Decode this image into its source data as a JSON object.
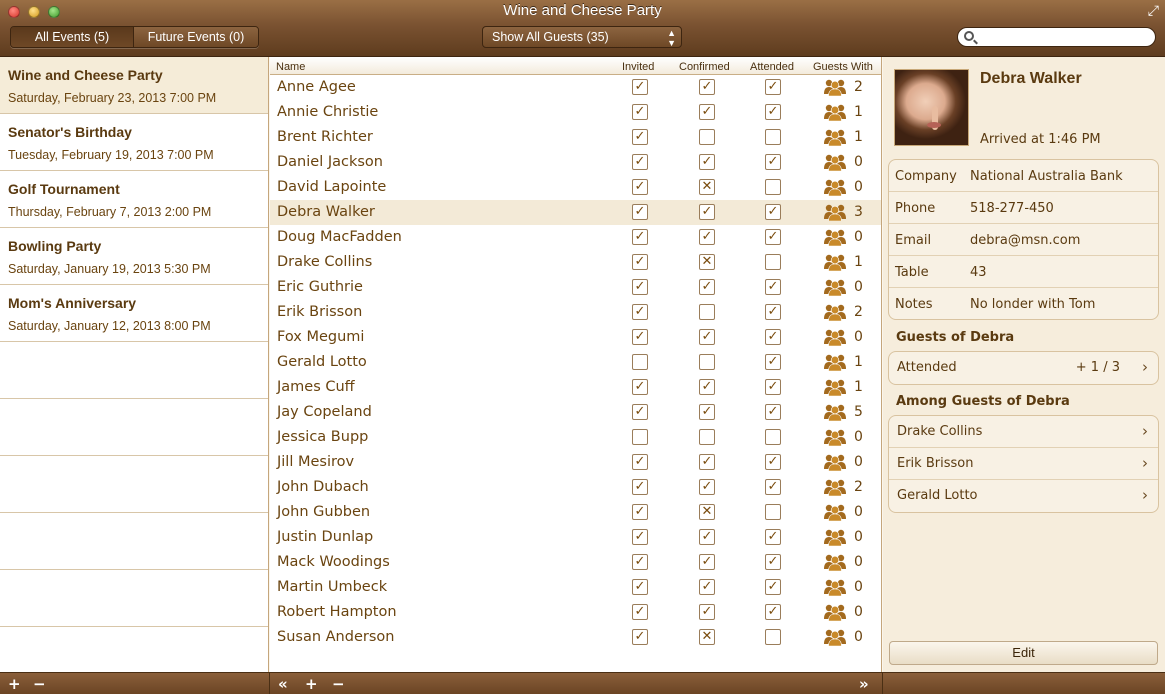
{
  "window": {
    "title": "Wine and Cheese Party"
  },
  "toolbar": {
    "all_events": "All Events (5)",
    "future_events": "Future Events (0)",
    "guest_filter": "Show All Guests (35)",
    "search_placeholder": ""
  },
  "events": [
    {
      "name": "Wine and Cheese Party",
      "date": "Saturday, February 23, 2013 7:00 PM",
      "selected": true
    },
    {
      "name": "Senator's Birthday",
      "date": "Tuesday, February 19, 2013 7:00 PM"
    },
    {
      "name": "Golf Tournament",
      "date": "Thursday, February 7, 2013 2:00 PM"
    },
    {
      "name": "Bowling Party",
      "date": "Saturday, January 19, 2013 5:30 PM"
    },
    {
      "name": "Mom's Anniversary",
      "date": "Saturday, January 12, 2013 8:00 PM"
    }
  ],
  "table": {
    "headers": {
      "name": "Name",
      "invited": "Invited",
      "confirmed": "Confirmed",
      "attended": "Attended",
      "guests_with": "Guests With"
    },
    "rows": [
      {
        "name": "Anne Agee",
        "invited": "check",
        "confirmed": "check",
        "attended": "check",
        "guests": "2"
      },
      {
        "name": "Annie Christie",
        "invited": "check",
        "confirmed": "check",
        "attended": "check",
        "guests": "1"
      },
      {
        "name": "Brent Richter",
        "invited": "check",
        "confirmed": "empty",
        "attended": "empty",
        "guests": "1"
      },
      {
        "name": "Daniel Jackson",
        "invited": "check",
        "confirmed": "check",
        "attended": "check",
        "guests": "0"
      },
      {
        "name": "David Lapointe",
        "invited": "check",
        "confirmed": "cross",
        "attended": "empty",
        "guests": "0"
      },
      {
        "name": "Debra Walker",
        "invited": "check",
        "confirmed": "check",
        "attended": "check",
        "guests": "3",
        "selected": true
      },
      {
        "name": "Doug MacFadden",
        "invited": "check",
        "confirmed": "check",
        "attended": "check",
        "guests": "0"
      },
      {
        "name": "Drake Collins",
        "invited": "check",
        "confirmed": "cross",
        "attended": "empty",
        "guests": "1"
      },
      {
        "name": "Eric Guthrie",
        "invited": "check",
        "confirmed": "check",
        "attended": "check",
        "guests": "0"
      },
      {
        "name": "Erik Brisson",
        "invited": "check",
        "confirmed": "empty",
        "attended": "check",
        "guests": "2"
      },
      {
        "name": "Fox Megumi",
        "invited": "check",
        "confirmed": "check",
        "attended": "check",
        "guests": "0"
      },
      {
        "name": "Gerald Lotto",
        "invited": "empty",
        "confirmed": "empty",
        "attended": "check",
        "guests": "1"
      },
      {
        "name": "James Cuff",
        "invited": "check",
        "confirmed": "check",
        "attended": "check",
        "guests": "1"
      },
      {
        "name": "Jay Copeland",
        "invited": "check",
        "confirmed": "check",
        "attended": "check",
        "guests": "5"
      },
      {
        "name": "Jessica Bupp",
        "invited": "empty",
        "confirmed": "empty",
        "attended": "empty",
        "guests": "0"
      },
      {
        "name": "Jill Mesirov",
        "invited": "check",
        "confirmed": "check",
        "attended": "check",
        "guests": "0"
      },
      {
        "name": "John Dubach",
        "invited": "check",
        "confirmed": "check",
        "attended": "check",
        "guests": "2"
      },
      {
        "name": "John Gubben",
        "invited": "check",
        "confirmed": "cross",
        "attended": "empty",
        "guests": "0"
      },
      {
        "name": "Justin Dunlap",
        "invited": "check",
        "confirmed": "check",
        "attended": "check",
        "guests": "0"
      },
      {
        "name": "Mack Woodings",
        "invited": "check",
        "confirmed": "check",
        "attended": "check",
        "guests": "0"
      },
      {
        "name": "Martin Umbeck",
        "invited": "check",
        "confirmed": "check",
        "attended": "check",
        "guests": "0"
      },
      {
        "name": "Robert Hampton",
        "invited": "check",
        "confirmed": "check",
        "attended": "check",
        "guests": "0"
      },
      {
        "name": "Susan Anderson",
        "invited": "check",
        "confirmed": "cross",
        "attended": "empty",
        "guests": "0"
      }
    ]
  },
  "detail": {
    "name": "Debra Walker",
    "arrived": "Arrived at 1:46 PM",
    "fields": [
      {
        "label": "Company",
        "value": "National Australia Bank"
      },
      {
        "label": "Phone",
        "value": "518-277-450"
      },
      {
        "label": "Email",
        "value": "debra@msn.com"
      },
      {
        "label": "Table",
        "value": "43"
      },
      {
        "label": "Notes",
        "value": "No londer with Tom"
      }
    ],
    "guests_of_header": "Guests of Debra",
    "attended_label": "Attended",
    "attended_value": "+ 1 / 3",
    "among_header": "Among Guests of Debra",
    "among": [
      "Drake Collins",
      "Erik Brisson",
      "Gerald Lotto"
    ],
    "edit_label": "Edit"
  },
  "bottom": {
    "add": "+",
    "remove": "−",
    "collapse": "«",
    "expand": "»"
  },
  "colors": {
    "accent_brown": "#7a5231",
    "text_brown": "#5a3a10",
    "selection": "#f3ead7"
  },
  "icons": [
    "close-icon",
    "minimize-icon",
    "zoom-icon",
    "fullscreen-icon",
    "search-icon",
    "checkbox-check-icon",
    "checkbox-cross-icon",
    "guests-icon",
    "chevron-right-icon"
  ]
}
